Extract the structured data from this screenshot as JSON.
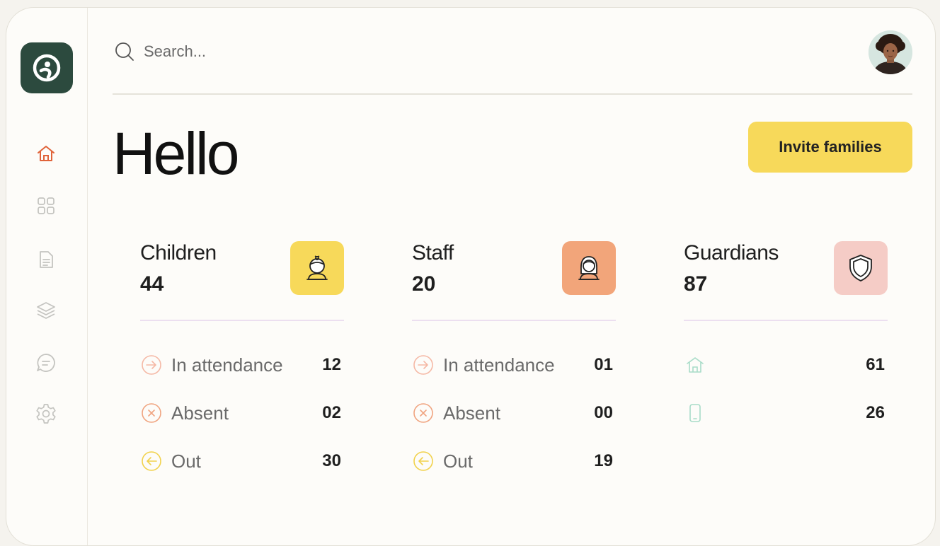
{
  "search": {
    "placeholder": "Search..."
  },
  "header": {
    "greeting": "Hello",
    "invite_label": "Invite families"
  },
  "colors": {
    "accent_yellow": "#f7d95a",
    "staff_orange": "#f2a57a",
    "guardian_pink": "#f5ccc6",
    "logo_green": "#2c4a3e",
    "nav_active": "#e0633a"
  },
  "sidebar": {
    "items": [
      {
        "name": "home-icon",
        "active": true
      },
      {
        "name": "grid-icon",
        "active": false
      },
      {
        "name": "document-icon",
        "active": false
      },
      {
        "name": "layers-icon",
        "active": false
      },
      {
        "name": "chat-icon",
        "active": false
      },
      {
        "name": "gear-icon",
        "active": false
      }
    ]
  },
  "cards": {
    "children": {
      "title": "Children",
      "count": "44",
      "icon": "child-icon",
      "rows": [
        {
          "icon": "arrow-in-icon",
          "label": "In attendance",
          "value": "12"
        },
        {
          "icon": "absent-icon",
          "label": "Absent",
          "value": "02"
        },
        {
          "icon": "arrow-out-icon",
          "label": "Out",
          "value": "30"
        }
      ]
    },
    "staff": {
      "title": "Staff",
      "count": "20",
      "icon": "staff-icon",
      "rows": [
        {
          "icon": "arrow-in-icon",
          "label": "In attendance",
          "value": "01"
        },
        {
          "icon": "absent-icon",
          "label": "Absent",
          "value": "00"
        },
        {
          "icon": "arrow-out-icon",
          "label": "Out",
          "value": "19"
        }
      ]
    },
    "guardians": {
      "title": "Guardians",
      "count": "87",
      "icon": "shield-icon",
      "rows": [
        {
          "icon": "home-icon",
          "value": "61"
        },
        {
          "icon": "phone-icon",
          "value": "26"
        }
      ]
    }
  }
}
